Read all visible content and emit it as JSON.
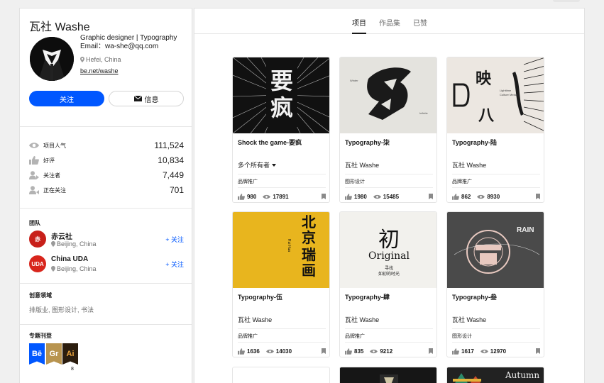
{
  "profile": {
    "name": "瓦社 Washe",
    "bio_line1": "Graphic designer | Typography",
    "bio_line2": "Email：wa-she@qq.com",
    "location": "Hefei, China",
    "link": "be.net/washe",
    "follow_label": "关注",
    "message_label": "信息"
  },
  "stats": [
    {
      "label": "项目人气",
      "value": "111,524",
      "icon": "eye-icon"
    },
    {
      "label": "好评",
      "value": "10,834",
      "icon": "thumbs-up-icon"
    },
    {
      "label": "关注者",
      "value": "7,449",
      "icon": "followers-icon"
    },
    {
      "label": "正在关注",
      "value": "701",
      "icon": "following-icon"
    }
  ],
  "team": {
    "title": "团队",
    "members": [
      {
        "name": "赤云社",
        "location": "Beijing, China",
        "follow": "+ 关注",
        "logo_text": "赤",
        "logo_color": "#c8201a"
      },
      {
        "name": "China UDA",
        "location": "Beijing, China",
        "follow": "+ 关注",
        "logo_text": "UDA",
        "logo_color": "#d8251c"
      }
    ]
  },
  "fields": {
    "title": "创意领域",
    "text": "排版业, 图形设计, 书法"
  },
  "features": {
    "title": "专题刊登",
    "badges": [
      {
        "label": "Bē",
        "color": "#0057ff"
      },
      {
        "label": "Gr",
        "color": "#b8944f"
      },
      {
        "label": "Ai",
        "color": "#2b1d0e"
      }
    ],
    "count": "8"
  },
  "tabs": [
    {
      "label": "项目",
      "active": true
    },
    {
      "label": "作品集",
      "active": false
    },
    {
      "label": "已赞",
      "active": false
    }
  ],
  "projects": [
    {
      "title": "Shock the game-要疯",
      "owner": "多个所有者",
      "field": "品牌推广",
      "likes": "980",
      "views": "17891"
    },
    {
      "title": "Typography-柒",
      "owner": "瓦社 Washe",
      "field": "图形设计",
      "likes": "1980",
      "views": "15485"
    },
    {
      "title": "Typography-陆",
      "owner": "瓦社 Washe",
      "field": "品牌推广",
      "likes": "862",
      "views": "8930"
    },
    {
      "title": "Typography-伍",
      "owner": "瓦社 Washe",
      "field": "品牌推广",
      "likes": "1636",
      "views": "14030"
    },
    {
      "title": "Typography-肆",
      "owner": "瓦社 Washe",
      "field": "品牌推广",
      "likes": "835",
      "views": "9212"
    },
    {
      "title": "Typography-叁",
      "owner": "瓦社 Washe",
      "field": "图形设计",
      "likes": "1617",
      "views": "12970"
    }
  ],
  "thumb_text": {
    "shock": "要疯",
    "qi_tag_left": "Winter",
    "qi_tag_right": "Infinite",
    "qi_char": "冬",
    "lu_char1": "映",
    "lu_char2": "八",
    "lu_sub1": "Lighttime",
    "lu_sub2": "Culture Media",
    "wu_char1": "北京",
    "wu_char2": "瑞画",
    "wu_side": "Rui Hua",
    "si_char": "初",
    "si_en": "Original",
    "si_sub1": "寻找",
    "si_sub2": "如初的时光",
    "san_text": "RAIN",
    "autumn": "Autumn"
  }
}
